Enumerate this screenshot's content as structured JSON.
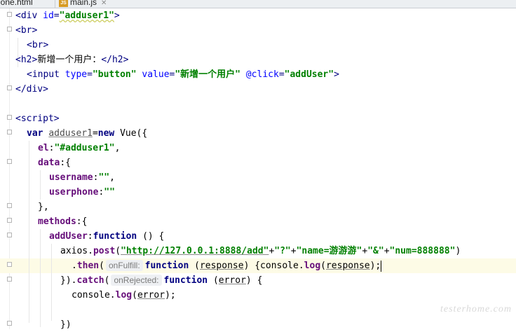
{
  "tabs": [
    {
      "label": "hone.html",
      "active": false
    },
    {
      "label": "main.js",
      "badge": "JS",
      "active": true
    }
  ],
  "code_lines": [
    [
      "<div id=\"adduser1\">"
    ],
    [
      "<br>"
    ],
    [
      "<br>"
    ],
    [
      "<h2>新增一个用户：</h2>"
    ],
    [
      "<input type=\"button\" value=\"新增一个用户\" @click=\"addUser\">"
    ],
    [
      "</div>"
    ],
    [
      ""
    ],
    [
      "<script>"
    ],
    [
      "var adduser1=new Vue({"
    ],
    [
      "el:\"#adduser1\","
    ],
    [
      "data:{"
    ],
    [
      "username:\"\","
    ],
    [
      "userphone:\"\""
    ],
    [
      "},"
    ],
    [
      "methods:{"
    ],
    [
      "addUser:function () {"
    ],
    [
      "axios.post(\"http://127.0.0.1:8888/add\"+\"?\"+\"name=游游游\"+\"&\"+\"num=888888\")"
    ],
    [
      ".then( onFulfill: function (response) {console.log(response);"
    ],
    [
      "}).catch( onRejected: function (error) {"
    ],
    [
      "console.log(error);"
    ],
    [
      ""
    ],
    [
      "})"
    ]
  ],
  "tokens": {
    "l0": [
      "<div ",
      "id",
      "=",
      "\"adduser1\"",
      ">"
    ],
    "l1": [
      "<br>"
    ],
    "l2": [
      "<br>"
    ],
    "l3": [
      "<h2>",
      "新增一个用户：",
      "</h2>"
    ],
    "l4": [
      "<input ",
      "type",
      "=",
      "\"button\"",
      " ",
      "value",
      "=",
      "\"新增一个用户\"",
      " ",
      "@click",
      "=",
      "\"addUser\"",
      ">"
    ],
    "l5": [
      "</div>"
    ],
    "l7": [
      "<script>"
    ],
    "l8": [
      "var",
      " ",
      "adduser1",
      "=",
      "new",
      " Vue({"
    ],
    "l9": [
      "el",
      ":",
      "\"#adduser1\"",
      ","
    ],
    "l10": [
      "data",
      ":{"
    ],
    "l11": [
      "username",
      ":",
      "\"\"",
      ","
    ],
    "l12": [
      "userphone",
      ":",
      "\"\""
    ],
    "l13": [
      "},"
    ],
    "l14": [
      "methods",
      ":{"
    ],
    "l15": [
      "addUser",
      ":",
      "function",
      " () {"
    ],
    "l16": [
      "axios.",
      "post",
      "(",
      "\"http://127.0.0.1:8888/add\"",
      "+",
      "\"?\"",
      "+",
      "\"name=游游游\"",
      "+",
      "\"&\"",
      "+",
      "\"num=888888\"",
      ")"
    ],
    "l17": [
      ".",
      "then",
      "(",
      "onFulfill:",
      "function",
      " (",
      "response",
      ") {",
      "console.",
      "log",
      "(",
      "response",
      ");"
    ],
    "l18": [
      "}).",
      "catch",
      "(",
      "onRejected:",
      "function",
      " (",
      "error",
      ") {"
    ],
    "l19": [
      "console.",
      "log",
      "(",
      "error",
      ");"
    ],
    "l21": [
      "})"
    ]
  },
  "watermark": "testerhome.com",
  "colors": {
    "tag": "#000080",
    "attribute": "#0000ff",
    "string": "#008000",
    "keyword": "#000080",
    "property": "#660e7a",
    "current_line": "#fdfbe6",
    "hint_bg": "#eef0f3"
  }
}
